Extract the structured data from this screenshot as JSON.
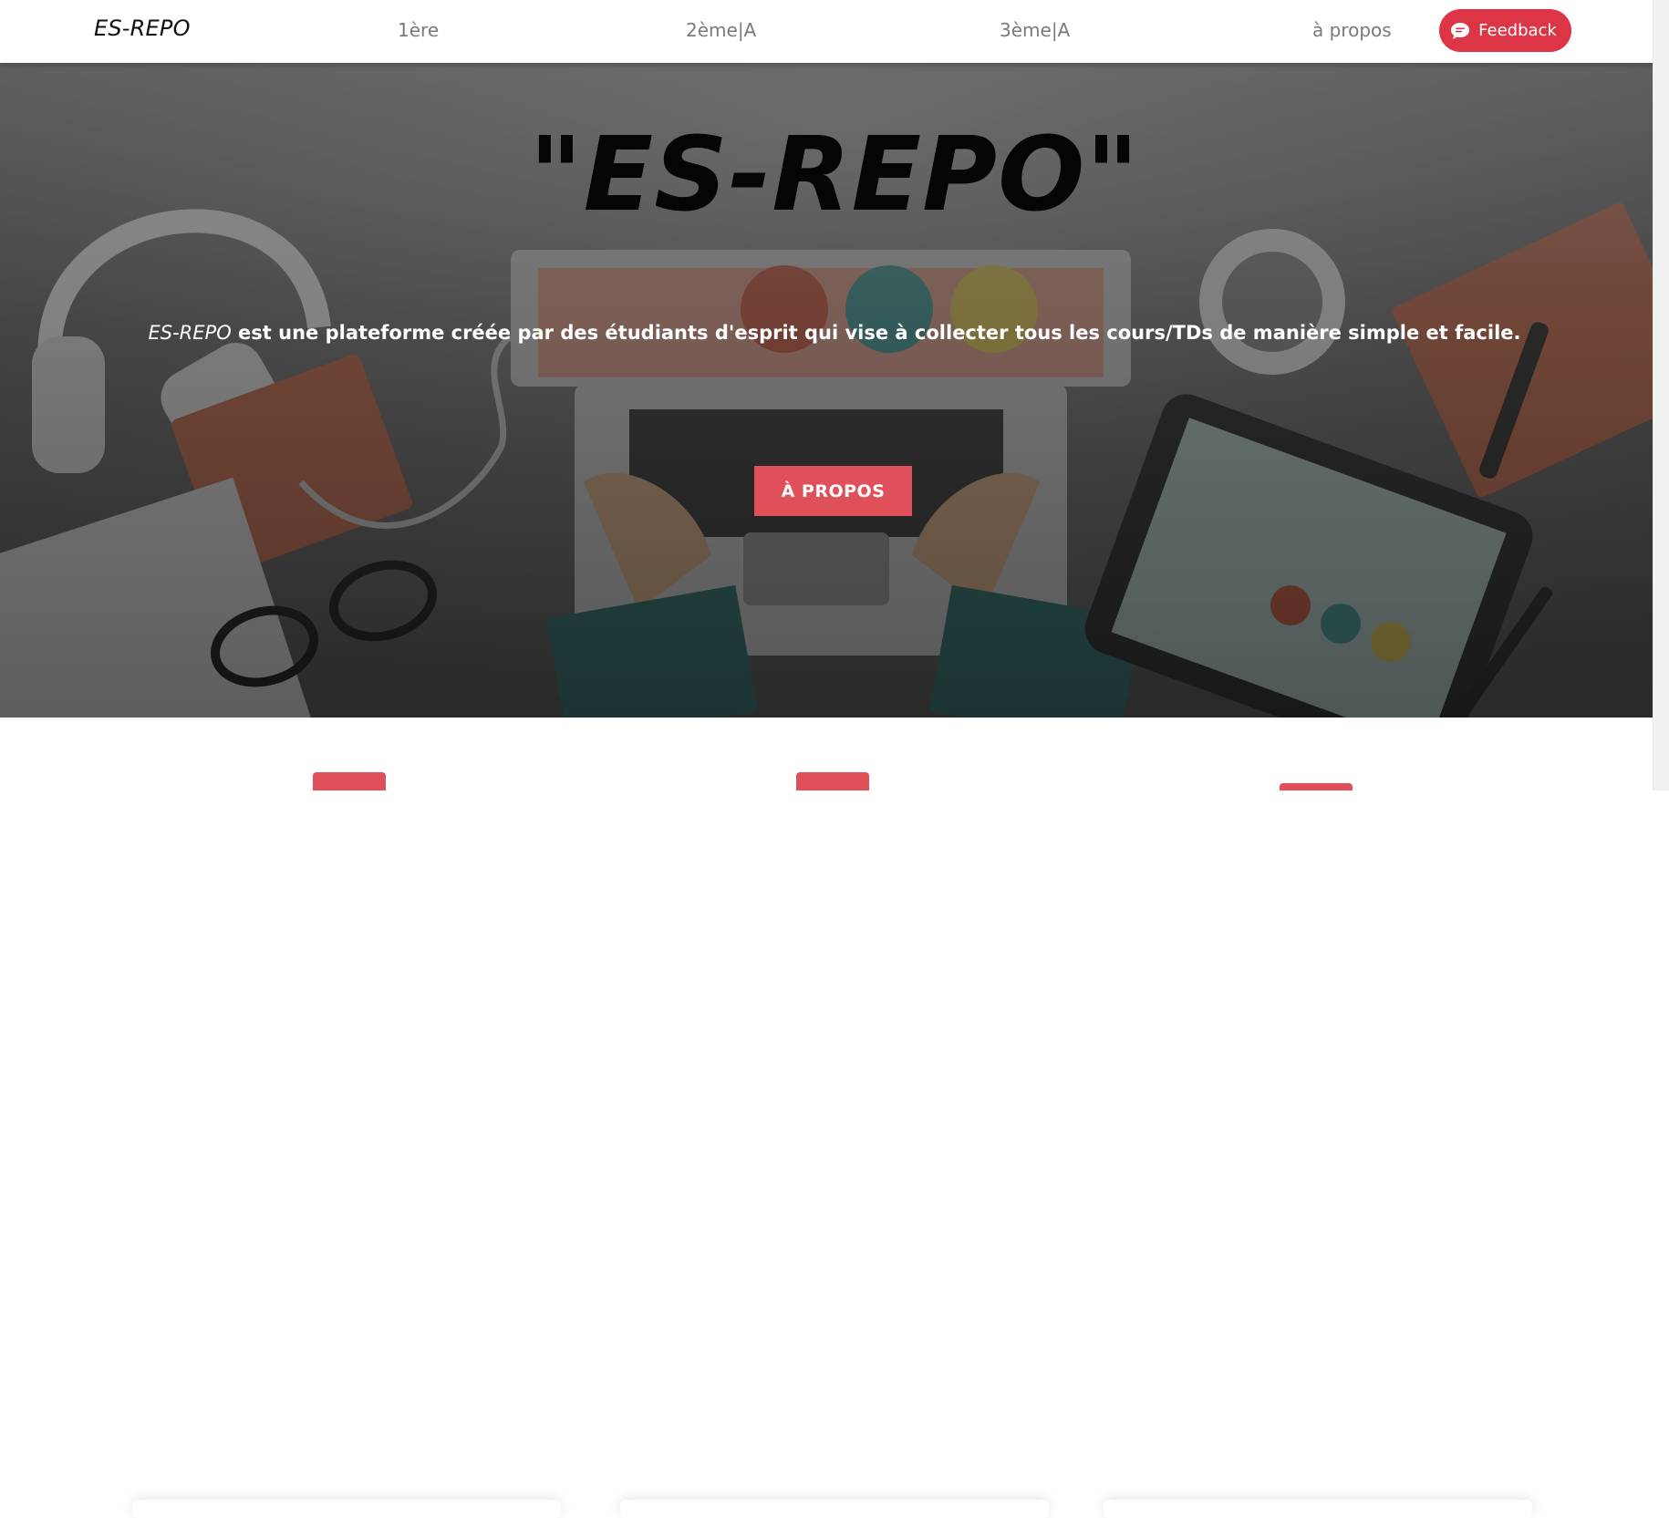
{
  "navbar": {
    "brand": "ES-REPO",
    "links": [
      "1ère",
      "2ème|A",
      "3ème|A",
      "à propos"
    ],
    "feedback_label": "Feedback",
    "feedback_color": "#dc3545"
  },
  "hero": {
    "title": "\"ES-REPO\"",
    "subtitle_em": "ES-REPO",
    "subtitle_rest": " est une plateforme créée par des étudiants d'esprit qui vise à collecter tous les cours/TDs de manière simple et facile.",
    "button_label": "À PROPOS",
    "accent": "#e0505b"
  },
  "icons": {
    "feedback": "chat-bubble-icon"
  }
}
